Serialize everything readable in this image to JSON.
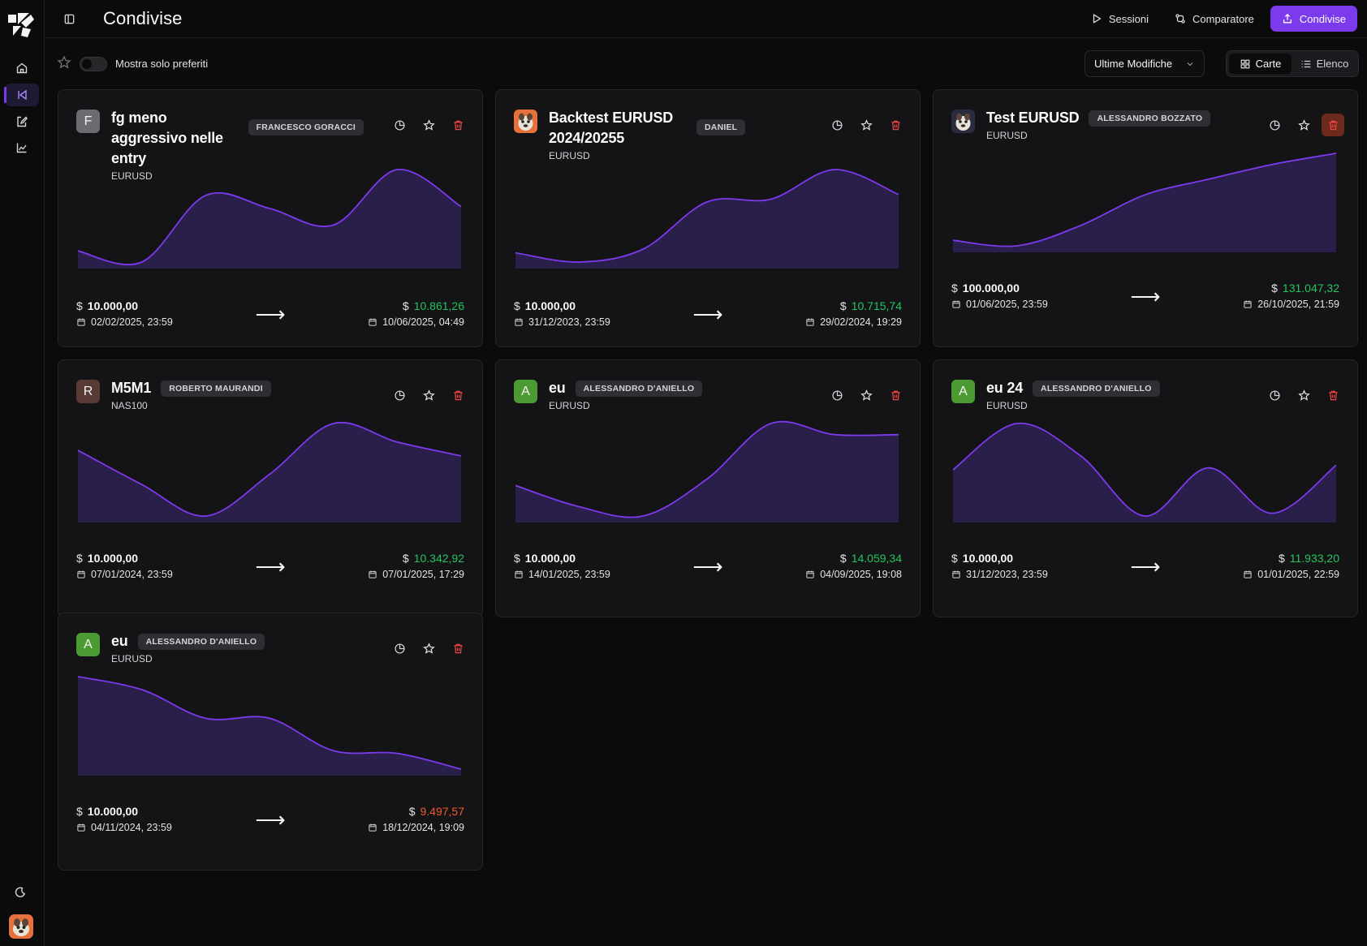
{
  "colors": {
    "accent": "#7c3aed",
    "positive": "#22c55e",
    "negative": "#f0582f",
    "delete": "#ef4444"
  },
  "page": {
    "title": "Condivise"
  },
  "topbar": {
    "sessions_label": "Sessioni",
    "comparator_label": "Comparatore",
    "share_label": "Condivise"
  },
  "filters": {
    "favorites_label": "Mostra solo preferiti",
    "sort_value": "Ultime Modifiche",
    "view_cards_label": "Carte",
    "view_list_label": "Elenco",
    "active_view": "Carte"
  },
  "cards": [
    {
      "title": "fg meno aggressivo nelle entry",
      "owner": "FRANCESCO GORACCI",
      "symbol": "EURUSD",
      "avatar": "F",
      "avatar_color": "#6b6b72",
      "start_amount": "10.000,00",
      "start_date": "02/02/2025, 23:59",
      "end_amount": "10.861,26",
      "end_date": "10/06/2025, 04:49",
      "result": "positive",
      "equity": [
        0.12,
        0.0,
        0.72,
        0.58,
        0.4,
        1.0,
        0.6
      ]
    },
    {
      "title": "Backtest EURUSD 2024/20255",
      "owner": "DANIEL",
      "symbol": "EURUSD",
      "avatar": "",
      "avatar_color": "#e8703a",
      "start_amount": "10.000,00",
      "start_date": "31/12/2023, 23:59",
      "end_amount": "10.715,74",
      "end_date": "29/02/2024, 19:29",
      "result": "positive",
      "equity": [
        0.1,
        0.0,
        0.14,
        0.65,
        0.68,
        1.0,
        0.73
      ]
    },
    {
      "title": "Test EURUSD",
      "owner": "ALESSANDRO BOZZATO",
      "symbol": "EURUSD",
      "avatar": "",
      "avatar_color": "#2b2b40",
      "start_amount": "100.000,00",
      "start_date": "01/06/2025, 23:59",
      "end_amount": "131.047,32",
      "end_date": "26/10/2025, 21:59",
      "result": "positive",
      "equity": [
        0.06,
        0.0,
        0.22,
        0.55,
        0.72,
        0.88,
        1.0
      ]
    },
    {
      "title": "M5M1",
      "owner": "ROBERTO MAURANDI",
      "symbol": "NAS100",
      "avatar": "R",
      "avatar_color": "#5a3a34",
      "start_amount": "10.000,00",
      "start_date": "07/01/2024, 23:59",
      "end_amount": "10.342,92",
      "end_date": "07/01/2025, 17:29",
      "result": "positive",
      "equity": [
        0.71,
        0.34,
        0.0,
        0.45,
        1.0,
        0.8,
        0.65
      ]
    },
    {
      "title": "eu",
      "owner": "ALESSANDRO D'ANIELLO",
      "symbol": "EURUSD",
      "avatar": "A",
      "avatar_color": "#4b9a32",
      "start_amount": "10.000,00",
      "start_date": "14/01/2025, 23:59",
      "end_amount": "14.059,34",
      "end_date": "04/09/2025, 19:08",
      "result": "positive",
      "equity": [
        0.33,
        0.1,
        0.0,
        0.4,
        1.0,
        0.88,
        0.88
      ]
    },
    {
      "title": "eu 24",
      "owner": "ALESSANDRO D'ANIELLO",
      "symbol": "EURUSD",
      "avatar": "A",
      "avatar_color": "#4b9a32",
      "start_amount": "10.000,00",
      "start_date": "31/12/2023, 23:59",
      "end_amount": "11.933,20",
      "end_date": "01/01/2025, 22:59",
      "result": "positive",
      "equity": [
        0.5,
        1.0,
        0.65,
        0.0,
        0.52,
        0.03,
        0.55
      ]
    },
    {
      "title": "eu",
      "owner": "ALESSANDRO D'ANIELLO",
      "symbol": "EURUSD",
      "avatar": "A",
      "avatar_color": "#4b9a32",
      "start_amount": "10.000,00",
      "start_date": "04/11/2024, 23:59",
      "end_amount": "9.497,57",
      "end_date": "18/12/2024, 19:09",
      "result": "negative",
      "equity": [
        1.0,
        0.86,
        0.55,
        0.55,
        0.2,
        0.17,
        0.0
      ]
    }
  ]
}
